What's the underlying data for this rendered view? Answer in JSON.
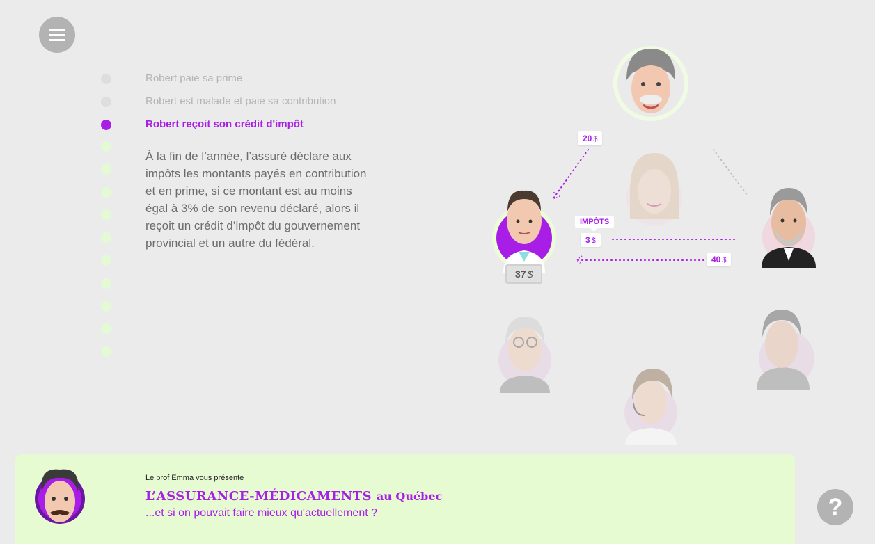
{
  "menu": {
    "icon": "hamburger-menu-icon"
  },
  "steps": [
    {
      "label": "Robert paie sa prime",
      "state": "done"
    },
    {
      "label": "Robert est malade et paie sa contribution",
      "state": "done"
    },
    {
      "label": "Robert reçoit son crédit d'impôt",
      "state": "active"
    }
  ],
  "future_step_count": 10,
  "description": "À la fin de l’année, l’assuré déclare aux impôts les montants payés en contribution et en prime, si ce montant est au moins égal à 3% de son revenu déclaré, alors il reçoit un crédit d’impôt du gouvernement provincial et un autre du fédéral.",
  "diagram": {
    "tag_top": {
      "amount": "20",
      "currency": "$"
    },
    "impots_label": "IMPÔTS",
    "tag_impots": {
      "amount": "3",
      "currency": "$"
    },
    "tag_right": {
      "amount": "40",
      "currency": "$"
    },
    "price": {
      "amount": "37",
      "currency": "$"
    }
  },
  "footer": {
    "presente": "Le prof Emma vous présente",
    "title_main": "L’ASSURANCE-MÉDICAMENTS",
    "title_suffix": "au Québec",
    "subtitle": "...et si on pouvait faire mieux qu'actuellement ?"
  },
  "help": {
    "label": "?"
  },
  "colors": {
    "accent": "#a81ee6",
    "footer_bg": "#e7fbd2",
    "background": "#ebebeb"
  }
}
